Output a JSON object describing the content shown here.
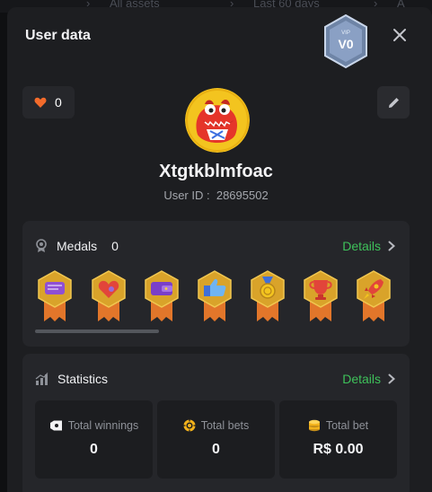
{
  "background_tabs": [
    "All assets",
    "Last 60 days"
  ],
  "modal": {
    "title": "User data"
  },
  "vip": {
    "badge_text": "VIP",
    "level": "V0"
  },
  "profile": {
    "likes": "0",
    "username": "Xtgtkblmfoac",
    "user_id_label": "User ID :",
    "user_id": "28695502"
  },
  "medals": {
    "title": "Medals",
    "count": "0",
    "details_label": "Details",
    "items": [
      "chat-medal",
      "heart-medal",
      "wallet-medal",
      "thumbs-up-medal",
      "gold-coin-medal",
      "trophy-medal",
      "rocket-medal"
    ]
  },
  "statistics": {
    "title": "Statistics",
    "details_label": "Details",
    "items": [
      {
        "label": "Total winnings",
        "value": "0",
        "icon": "ticket-icon"
      },
      {
        "label": "Total bets",
        "value": "0",
        "icon": "chip-icon"
      },
      {
        "label": "Total bet",
        "value": "R$ 0.00",
        "icon": "coins-icon"
      }
    ]
  },
  "colors": {
    "accent_green": "#3ec15a",
    "heart": "#f36b2b",
    "medal_gold": "#d9a32a",
    "ribbon": "#e2762a"
  }
}
